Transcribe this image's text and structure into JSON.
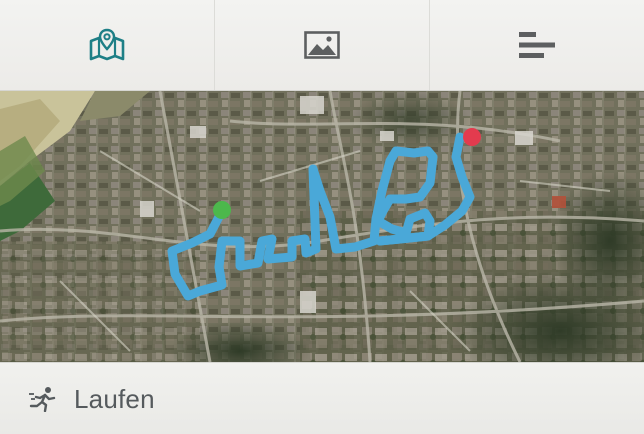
{
  "tabs": [
    {
      "icon": "map-pin-icon",
      "active": true
    },
    {
      "icon": "image-icon",
      "active": false
    },
    {
      "icon": "bar-list-icon",
      "active": false
    }
  ],
  "map": {
    "route_color": "#4aa8d8",
    "start_marker_color": "#4cb84c",
    "end_marker_color": "#e33b4e"
  },
  "activity": {
    "icon": "running-icon",
    "label": "Laufen"
  },
  "colors": {
    "accent": "#1e7f86",
    "icon_gray": "#5d5f60"
  }
}
